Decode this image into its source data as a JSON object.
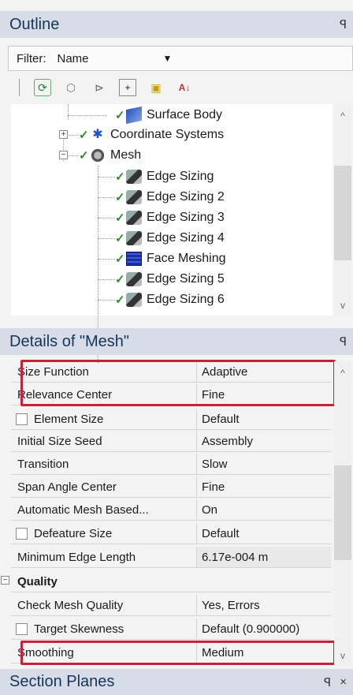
{
  "outline": {
    "title": "Outline",
    "filter_label": "Filter:",
    "filter_value": "Name",
    "tree": {
      "surface_body": "Surface Body",
      "coordinate_systems": "Coordinate Systems",
      "mesh": "Mesh",
      "children": [
        "Edge Sizing",
        "Edge Sizing 2",
        "Edge Sizing 3",
        "Edge Sizing 4",
        "Face Meshing",
        "Edge Sizing 5",
        "Edge Sizing 6"
      ]
    }
  },
  "details": {
    "title": "Details of \"Mesh\"",
    "rows": [
      {
        "key": "Size Function",
        "value": "Adaptive"
      },
      {
        "key": "Relevance Center",
        "value": "Fine"
      },
      {
        "key": "Element Size",
        "value": "Default"
      },
      {
        "key": "Initial Size Seed",
        "value": "Assembly"
      },
      {
        "key": "Transition",
        "value": "Slow"
      },
      {
        "key": "Span Angle Center",
        "value": "Fine"
      },
      {
        "key": "Automatic Mesh Based...",
        "value": "On"
      },
      {
        "key": "Defeature Size",
        "value": "Default"
      },
      {
        "key": "Minimum Edge Length",
        "value": "6.17e-004 m"
      },
      {
        "key": "Quality",
        "value": ""
      },
      {
        "key": "Check Mesh Quality",
        "value": "Yes, Errors"
      },
      {
        "key": "Target Skewness",
        "value": "Default (0.900000)"
      },
      {
        "key": "Smoothing",
        "value": "Medium"
      }
    ],
    "collapse_symbol": "−"
  },
  "section_planes": {
    "title": "Section Planes",
    "pin": "ꟼ",
    "close": "×"
  },
  "colors": {
    "title_bg": "#d7dde7",
    "title_text": "#17345c",
    "highlight": "#c4233a",
    "check": "#2e8b2e"
  }
}
